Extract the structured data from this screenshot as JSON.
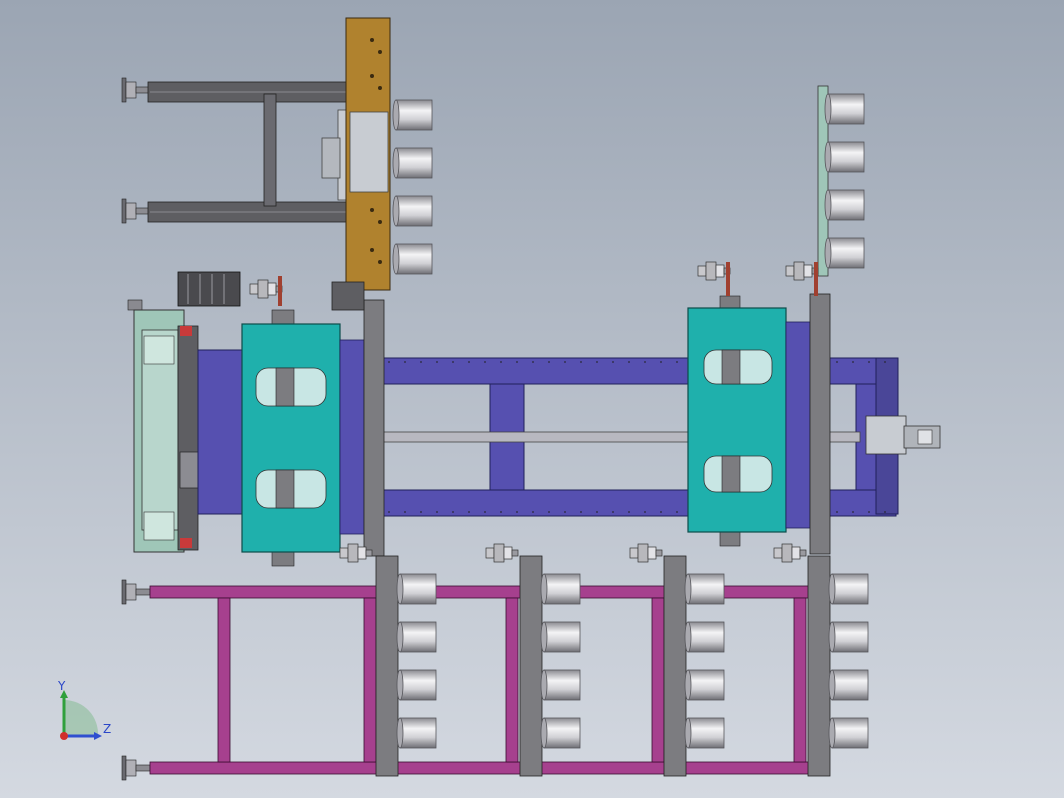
{
  "view": {
    "background_top": "#9ba5b3",
    "background_bottom": "#d4d9e1"
  },
  "colors": {
    "rail_purple": "#5650b0",
    "carriage_teal": "#1fb0ac",
    "bracket_orange": "#b0822e",
    "frame_magenta": "#a6408e",
    "post_gray": "#7c7c80",
    "frame_gray": "#5e5e62",
    "glass_green": "#9fc6b8",
    "roller_silver": "#d8d8dc"
  },
  "triad": {
    "y_label": "Y",
    "z_label": "Z",
    "y_axis_color": "#2fa03c",
    "z_axis_color": "#2f4fd0",
    "origin_color": "#d0302c"
  }
}
